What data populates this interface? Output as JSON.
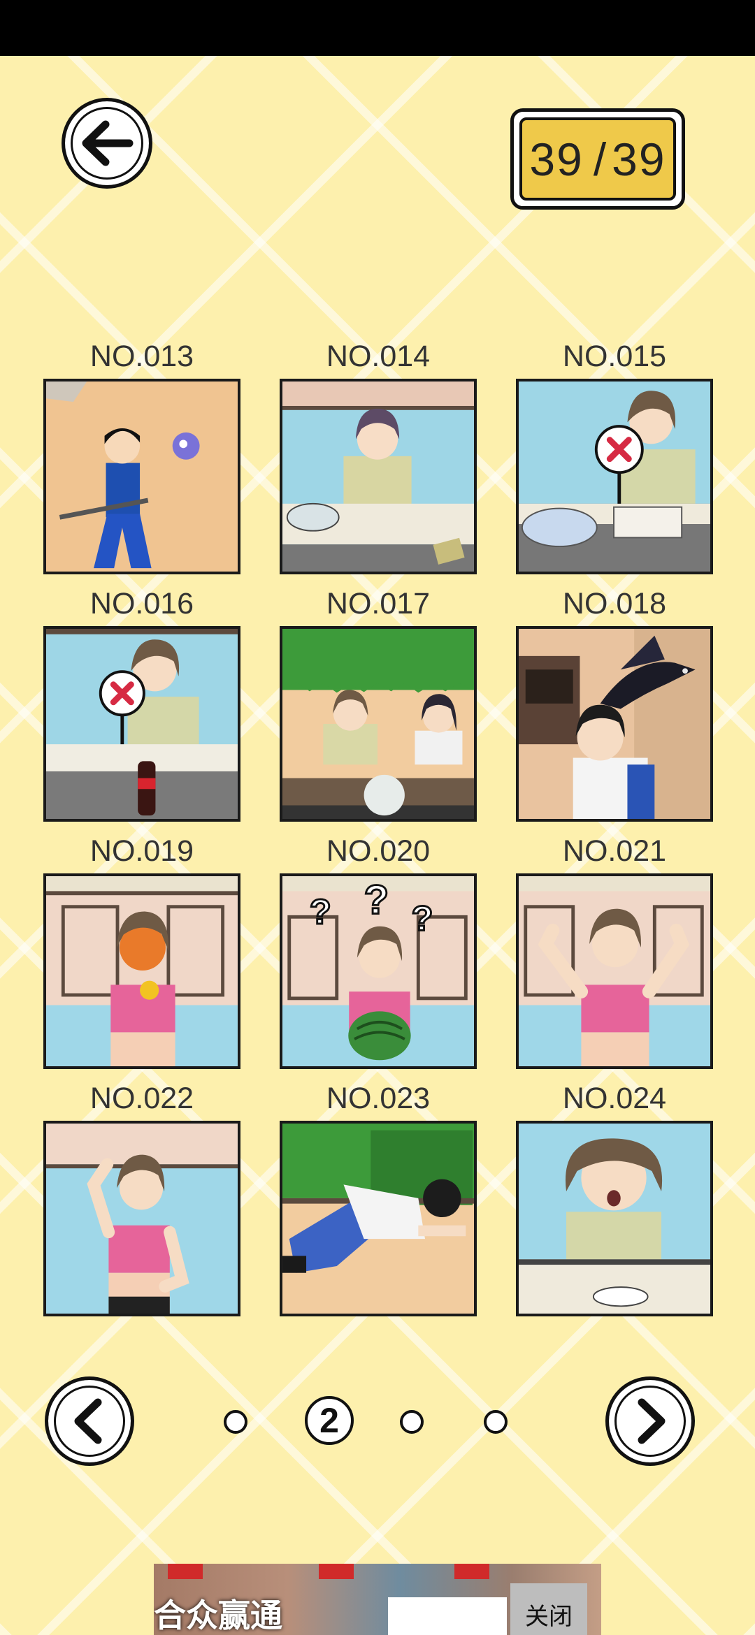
{
  "counter": {
    "current": "39",
    "separator": "/",
    "total": "39"
  },
  "cards": [
    {
      "label": "NO.013",
      "scene": "boy-sword"
    },
    {
      "label": "NO.014",
      "scene": "girl-desk-blue"
    },
    {
      "label": "NO.015",
      "scene": "girl-no-sign-book"
    },
    {
      "label": "NO.016",
      "scene": "girl-no-sign-cola"
    },
    {
      "label": "NO.017",
      "scene": "two-girls-class"
    },
    {
      "label": "NO.018",
      "scene": "boy-crow"
    },
    {
      "label": "NO.019",
      "scene": "girl-gym-eating"
    },
    {
      "label": "NO.020",
      "scene": "girl-watermelon"
    },
    {
      "label": "NO.021",
      "scene": "girl-gym-flex"
    },
    {
      "label": "NO.022",
      "scene": "girl-gym-pose"
    },
    {
      "label": "NO.023",
      "scene": "man-crawling"
    },
    {
      "label": "NO.024",
      "scene": "girl-shocked"
    }
  ],
  "pagination": {
    "current_page": "2"
  },
  "ad": {
    "brand": "合众赢通",
    "close_label": "关闭"
  },
  "colors": {
    "background": "#fdf0ad",
    "counter_fill": "#efc94a",
    "outline": "#111111"
  },
  "icons": {
    "back": "arrow-left-icon",
    "prev": "chevron-left-icon",
    "next": "chevron-right-icon"
  }
}
